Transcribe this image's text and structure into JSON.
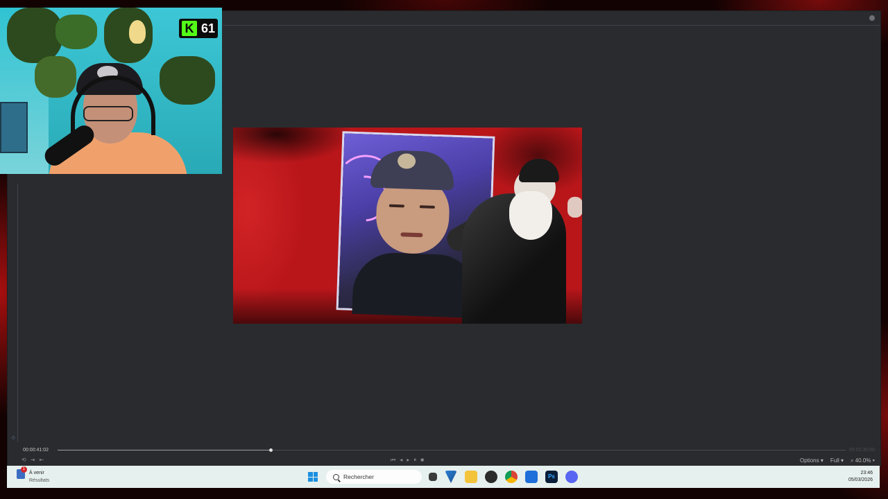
{
  "overlay": {
    "kick_viewer_count": "61",
    "kick_logo_letter": "K"
  },
  "player": {
    "timecode_current": "00:00:41:02",
    "timecode_end": "00:02:30:00",
    "progress_fraction": 0.27,
    "options_label": "Options",
    "resolution_label": "Full",
    "zoom_label": "40.0%"
  },
  "taskbar": {
    "widget_title": "À venir",
    "widget_subtitle": "Résultats",
    "widget_badge": "1",
    "search_placeholder": "Rechercher",
    "apps": [
      "file-explorer-dark-icon",
      "vscode-like-icon",
      "folder-icon",
      "obs-icon",
      "chrome-icon",
      "kick-app-icon",
      "photoshop-icon",
      "discord-icon"
    ],
    "clock_time": "23:46",
    "clock_date": "05/03/2026"
  },
  "colors": {
    "kick_green": "#53fc18",
    "windows_blue": "#1c8fe0",
    "app_bg": "#2a2b2e"
  }
}
